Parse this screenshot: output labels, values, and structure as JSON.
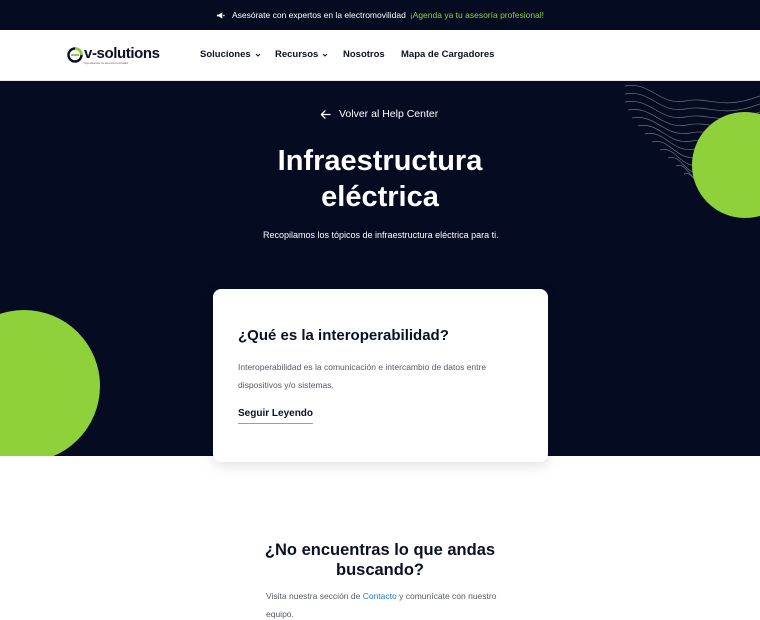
{
  "announcement": {
    "icon": "megaphone-icon",
    "text": "Asesórate con expertos en la electromovilidad",
    "cta": "¡Agenda ya tu asesoría profesional!"
  },
  "header": {
    "logo_text": "v-solutions",
    "logo_tagline": "impulsando la electromovilidad",
    "nav": [
      {
        "label": "Soluciones",
        "has_dropdown": true
      },
      {
        "label": "Recursos",
        "has_dropdown": true
      },
      {
        "label": "Nosotros",
        "has_dropdown": false
      },
      {
        "label": "Mapa de Cargadores",
        "has_dropdown": false
      }
    ]
  },
  "hero": {
    "back_label": "Volver al Help Center",
    "title_line1": "Infraestructura",
    "title_line2": "eléctrica",
    "subtitle": "Recopilamos los tópicos de infraestructura eléctrica para ti."
  },
  "article_card": {
    "title": "¿Qué es la interoperabilidad?",
    "body": "Interoperabilidad es la comunicación e intercambio de datos entre dispositivos y/o sistemas.",
    "link_label": "Seguir Leyendo"
  },
  "help": {
    "title": "¿No encuentras lo que andas buscando?",
    "text_before": "Visita nuestra sección de",
    "link_label": "Contacto",
    "text_after": "y comunícate con nuestro equipo."
  },
  "colors": {
    "navy": "#050c22",
    "accent_green": "#8fd13a",
    "link_blue": "#1f7ae0"
  }
}
